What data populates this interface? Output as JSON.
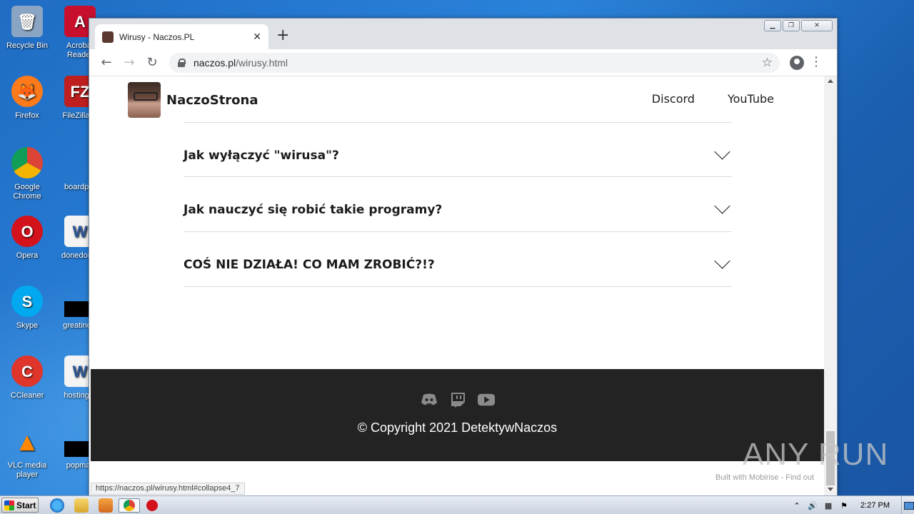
{
  "desktop": {
    "icons": [
      {
        "label": "Recycle Bin",
        "color": "#8aa4c4",
        "symbol": "🗑"
      },
      {
        "label": "Acrobat Reader",
        "color": "#c8102e",
        "symbol": "A"
      },
      {
        "label": "Firefox",
        "color": "#ff7a1a",
        "symbol": "🦊"
      },
      {
        "label": "FileZilla C",
        "color": "#bf1f1f",
        "symbol": "FZ"
      },
      {
        "label": "Google Chrome",
        "color": "#2b7de9",
        "symbol": "◉"
      },
      {
        "label": "boardpre",
        "color": "#2a82d9",
        "symbol": ""
      },
      {
        "label": "Opera",
        "color": "#d4121b",
        "symbol": "O"
      },
      {
        "label": "donedoma",
        "color": "#f4f4f4",
        "symbol": "W"
      },
      {
        "label": "Skype",
        "color": "#00a9f0",
        "symbol": "S"
      },
      {
        "label": "greatindiv",
        "color": "#000000",
        "symbol": ""
      },
      {
        "label": "CCleaner",
        "color": "#e0352b",
        "symbol": "C"
      },
      {
        "label": "hostingre",
        "color": "#f4f4f4",
        "symbol": "W"
      },
      {
        "label": "VLC media player",
        "color": "#ff8800",
        "symbol": "▲"
      },
      {
        "label": "popmail",
        "color": "#000000",
        "symbol": ""
      }
    ]
  },
  "browser": {
    "tab_title": "Wirusy - Naczos.PL",
    "tab_close": "✕",
    "new_tab": "+",
    "url_host": "naczos.pl",
    "url_path": "/wirusy.html",
    "back": "←",
    "forward": "→",
    "reload": "↻",
    "star": "☆",
    "menu": "⋮",
    "status_url": "https://naczos.pl/wirusy.html#collapse4_7"
  },
  "site": {
    "brand_name": "NaczoStrona",
    "nav": [
      "Discord",
      "YouTube"
    ],
    "faq": [
      "Jak wyłączyć \"wirusa\"?",
      "Jak nauczyć się robić takie programy?",
      "COŚ NIE DZIAŁA! CO MAM ZROBIĆ?!?"
    ],
    "footer_copyright": "© Copyright 2021 DetektywNaczos",
    "built_with": "Built with Mobirise - Find out"
  },
  "watermark": "ANY RUN",
  "taskbar": {
    "start_label": "Start",
    "clock": "2:27 PM"
  }
}
